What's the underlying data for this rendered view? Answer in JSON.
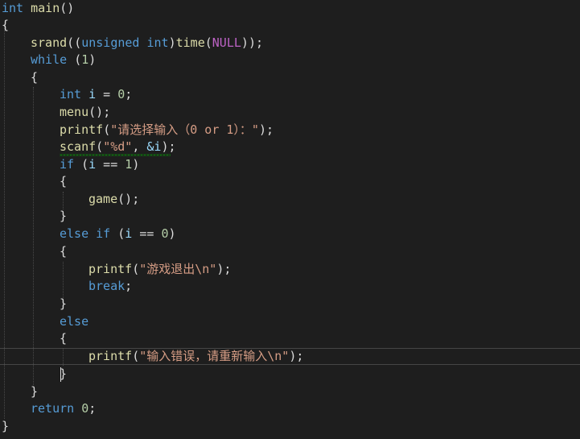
{
  "tokens": {
    "int": "int",
    "main": "main",
    "lparen": "(",
    "rparen": ")",
    "open_brace": "{",
    "close_brace": "}",
    "srand": "srand",
    "unsigned": "unsigned",
    "time": "time",
    "null": "NULL",
    "semicolon": ";",
    "while": "while",
    "one": "1",
    "zero": "0",
    "i": "i",
    "eq": " = ",
    "menu": "menu",
    "printf": "printf",
    "scanf": "scanf",
    "prompt_str": "\"请选择输入（0 or 1）：\"",
    "fmt_str": "\"%d\"",
    "comma_sp": ", ",
    "amp_i": "&i",
    "if": "if",
    "eqeq": " == ",
    "game": "game",
    "else": "else",
    "exit_str": "\"游戏退出\\n\"",
    "break": "break",
    "error_str": "\"输入错误，请重新输入\\n\"",
    "return": "return"
  }
}
